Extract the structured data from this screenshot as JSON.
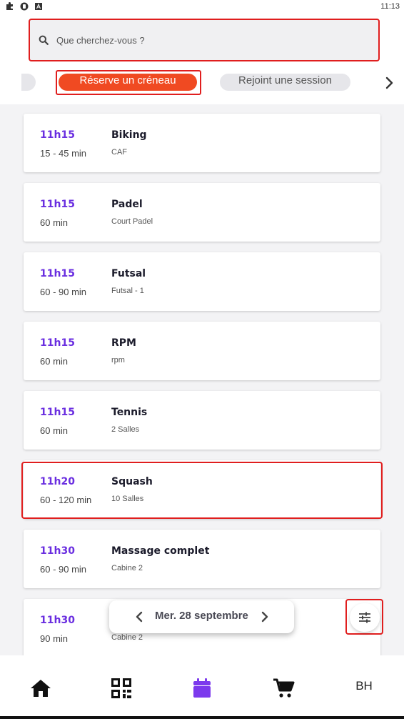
{
  "status_bar": {
    "time": "11:13",
    "icons": [
      "puzzle-icon",
      "shield-icon",
      "a-icon"
    ]
  },
  "search": {
    "placeholder": "Que cherchez-vous ?"
  },
  "tabs": {
    "active": "Réserve un créneau",
    "inactive": "Rejoint une session"
  },
  "sessions": [
    {
      "time": "11h15",
      "duration": "15 - 45 min",
      "name": "Biking",
      "place": "CAF"
    },
    {
      "time": "11h15",
      "duration": "60 min",
      "name": "Padel",
      "place": "Court Padel"
    },
    {
      "time": "11h15",
      "duration": "60 - 90 min",
      "name": "Futsal",
      "place": "Futsal - 1"
    },
    {
      "time": "11h15",
      "duration": "60 min",
      "name": "RPM",
      "place": "rpm"
    },
    {
      "time": "11h15",
      "duration": "60 min",
      "name": "Tennis",
      "place": "2 Salles"
    },
    {
      "time": "11h20",
      "duration": "60 - 120 min",
      "name": "Squash",
      "place": "10 Salles"
    },
    {
      "time": "11h30",
      "duration": "60 - 90 min",
      "name": "Massage complet",
      "place": "Cabine 2"
    },
    {
      "time": "11h30",
      "duration": "90 min",
      "name": "",
      "place": "Cabine 2"
    }
  ],
  "date_picker": {
    "label": "Mer. 28 septembre"
  },
  "bottom_nav": {
    "items": [
      "home-icon",
      "qr-code-icon",
      "calendar-icon",
      "cart-icon"
    ],
    "avatar": "BH"
  },
  "colors": {
    "accent": "#f04a22",
    "time_purple": "#6a2ee0",
    "nav_active": "#7c3aed",
    "highlight_frame": "#e01e1e"
  }
}
